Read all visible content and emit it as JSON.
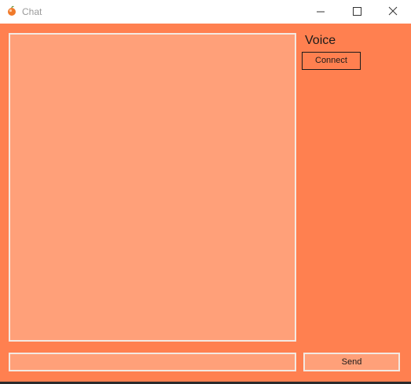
{
  "window": {
    "title": "Chat",
    "controls": {
      "minimize": "minimize-icon",
      "maximize": "maximize-icon",
      "close": "close-icon"
    }
  },
  "voice": {
    "label": "Voice",
    "connect_label": "Connect"
  },
  "composer": {
    "input_value": "",
    "send_label": "Send"
  },
  "colors": {
    "background": "#ff8050",
    "panel": "#ffa079",
    "panel_border": "#f3e9e2",
    "titlebar": "#ffffff"
  }
}
